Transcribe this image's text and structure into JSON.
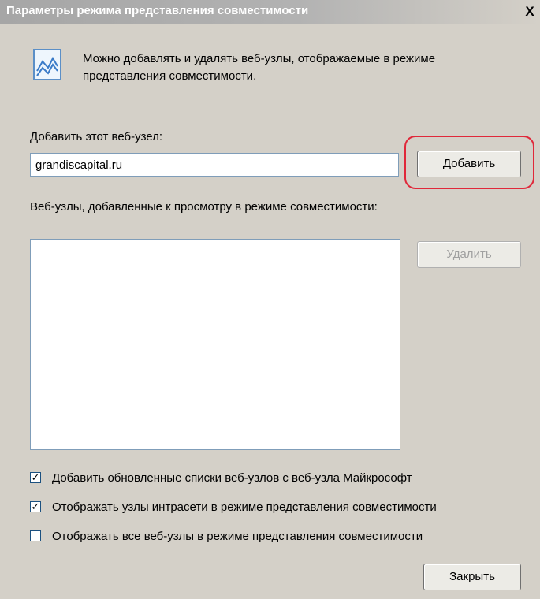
{
  "window": {
    "title": "Параметры режима представления совместимости",
    "close_glyph": "X"
  },
  "info": {
    "icon": "compatibility-view-icon",
    "text": "Можно добавлять и удалять веб-узлы, отображаемые в режиме представления совместимости."
  },
  "add_site": {
    "label": "Добавить этот веб-узел:",
    "value": "grandiscapital.ru",
    "button": "Добавить"
  },
  "site_list": {
    "label": "Веб-узлы, добавленные к просмотру в режиме совместимости:",
    "items": [],
    "remove_button": "Удалить"
  },
  "options": [
    {
      "label": "Добавить обновленные списки веб-узлов с веб-узла Майкрософт",
      "checked": true
    },
    {
      "label": "Отображать узлы интрасети в режиме представления совместимости",
      "checked": true
    },
    {
      "label": "Отображать все веб-узлы в режиме представления совместимости",
      "checked": false
    }
  ],
  "close_button": "Закрыть",
  "colors": {
    "highlight": "#e0283a",
    "dialog_bg": "#d4d0c8"
  }
}
